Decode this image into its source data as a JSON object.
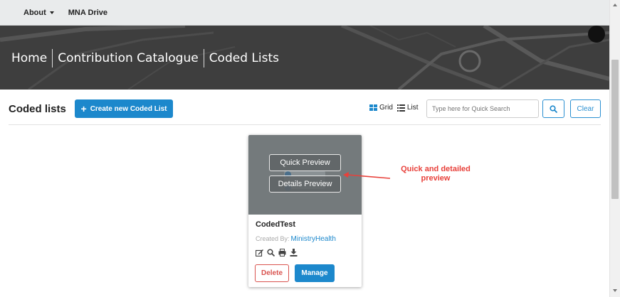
{
  "topnav": {
    "about_label": "About",
    "drive_label": "MNA Drive"
  },
  "breadcrumb": [
    "Home",
    "Contribution Catalogue",
    "Coded Lists"
  ],
  "toolbar": {
    "title": "Coded lists",
    "create_label": "Create new Coded List",
    "grid_label": "Grid",
    "list_label": "List",
    "search_placeholder": "Type here for Quick Search",
    "clear_label": "Clear"
  },
  "card": {
    "quick_preview_label": "Quick Preview",
    "details_preview_label": "Details Preview",
    "name": "CodedTest",
    "created_by_label": "Created By:",
    "author": "MinistryHealth",
    "delete_label": "Delete",
    "manage_label": "Manage",
    "icons": [
      "edit-icon",
      "search-icon",
      "print-icon",
      "download-icon"
    ]
  },
  "annotation": {
    "line1": "Quick and detailed",
    "line2": "preview"
  },
  "colors": {
    "primary": "#1c88cc",
    "danger": "#d9534f",
    "annotation": "#e8403a"
  }
}
